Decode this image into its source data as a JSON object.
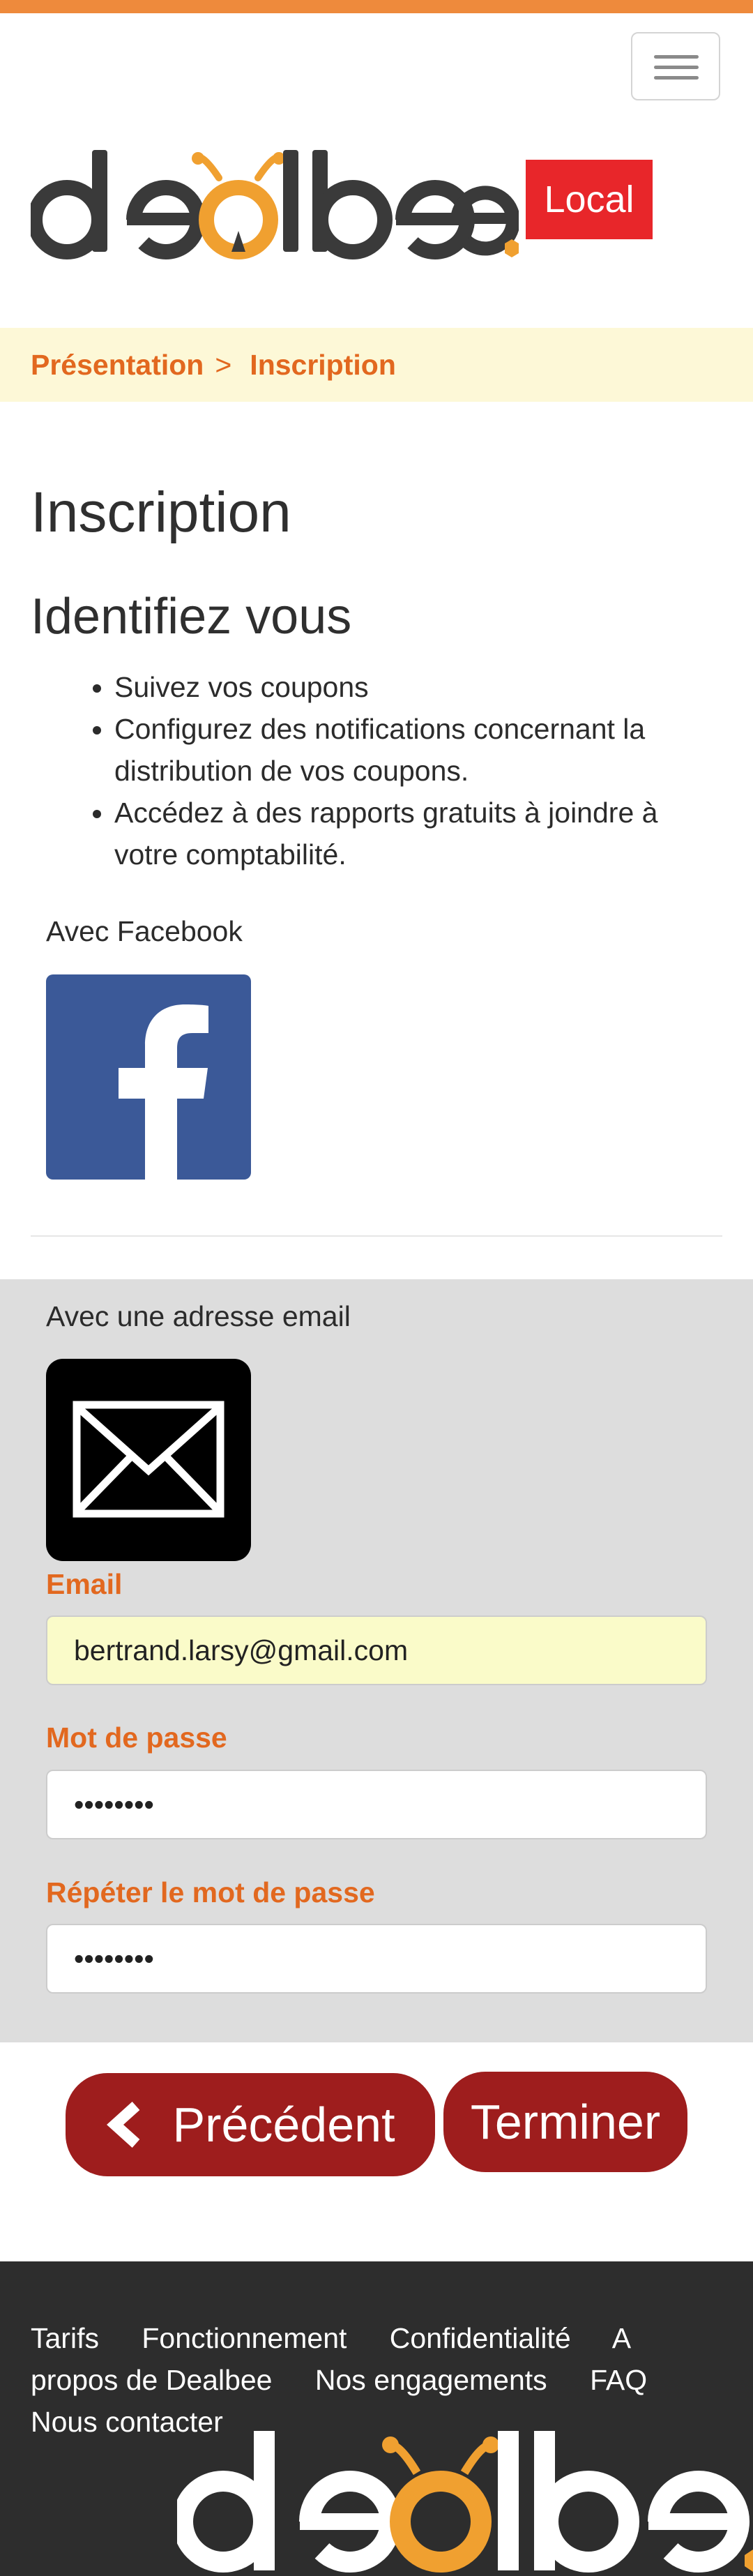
{
  "header": {
    "menu_icon": "hamburger-menu-icon",
    "brand": "dealbee",
    "badge": "Local",
    "colors": {
      "accent": "#ee8a3c",
      "brand_orange": "#e2681f",
      "badge_red": "#e8262a"
    }
  },
  "breadcrumb": {
    "items": [
      "Présentation",
      "Inscription"
    ],
    "separator": ">"
  },
  "main": {
    "title": "Inscription",
    "subtitle": "Identifiez vous",
    "benefits": [
      "Suivez vos coupons",
      "Configurez des notifications concernant la distribution de vos coupons.",
      "Accédez à des rapports gratuits à joindre à votre comptabilité."
    ]
  },
  "facebook": {
    "label": "Avec Facebook",
    "icon": "facebook-icon",
    "color": "#3b5998"
  },
  "email_signup": {
    "label": "Avec une adresse email",
    "icon": "envelope-icon",
    "email_label": "Email",
    "email_value": "bertrand.larsy@gmail.com",
    "password_label": "Mot de passe",
    "password_value": "12345678",
    "repeat_label": "Répéter le mot de passe",
    "repeat_value": "12345678"
  },
  "actions": {
    "previous": "Précédent",
    "finish": "Terminer",
    "button_color": "#9e1d1d"
  },
  "footer": {
    "links": [
      "Tarifs",
      "Fonctionnement",
      "Confidentialité",
      "A propos de Dealbee",
      "Nos engagements",
      "FAQ",
      "Nous contacter"
    ],
    "brand": "dealbee"
  }
}
